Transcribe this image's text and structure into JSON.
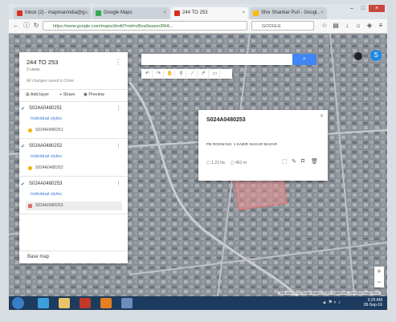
{
  "browser": {
    "tabs": [
      {
        "label": "Inbox (2) - mapmanindia@g...",
        "favicon_color": "#d93025"
      },
      {
        "label": "Google Maps",
        "favicon_color": "#34a853"
      },
      {
        "label": "244 TO 253",
        "favicon_color": "#d93025",
        "active": true
      },
      {
        "label": "Shiv Shankar Puri - Googl...",
        "favicon_color": "#fbbc05"
      }
    ],
    "url": "https://www.google.com/maps/d/edit?mid=zBea9wasm3RiA...",
    "search_engine_placeholder": "GOOGLE",
    "toolbar_icons": [
      "star-icon",
      "bookmark-icon",
      "download-icon",
      "home-icon",
      "shield-icon",
      "menu-icon"
    ]
  },
  "panel": {
    "title": "244 TO 253",
    "views": "3 views",
    "saved_status": "All changes saved in Drive",
    "actions": {
      "add_layer": "Add layer",
      "share": "Share",
      "preview": "Preview"
    },
    "layers": [
      {
        "name": "S024A0480251",
        "style": "Individual styles",
        "feature": "S024A0480251",
        "feature_color": "#f4b400",
        "selected": false
      },
      {
        "name": "S024A0480252",
        "style": "Individual styles",
        "feature": "S024A0480252",
        "feature_color": "#f4b400",
        "selected": false
      },
      {
        "name": "S024A0480253",
        "style": "Individual styles",
        "feature": "S024A0480253",
        "feature_color": "#e06b6b",
        "selected": true
      }
    ],
    "base_map": "Base map"
  },
  "map": {
    "tools": [
      "undo-icon",
      "redo-icon",
      "hand-icon",
      "marker-icon",
      "line-icon",
      "directions-icon",
      "ruler-icon"
    ],
    "search_button_icon": "search-icon",
    "profile_initial": "S",
    "attribution": "Map data ©2016 Google Imagery ©2016, DigitalGlobe, Cnes/Spot Image  Terms"
  },
  "popup": {
    "title": "S024A0480253",
    "description": "PB ROOM NO. 1 KABIR NAGAR BAZAR",
    "area": "1.21 ha",
    "perimeter": "461 m"
  },
  "taskbar": {
    "time": "3:25 AM",
    "date": "28-Sep-16"
  },
  "colors": {
    "accent": "#4285f4",
    "polygon_fill": "#e98f8f",
    "taskbar": "#1d3b5e"
  }
}
